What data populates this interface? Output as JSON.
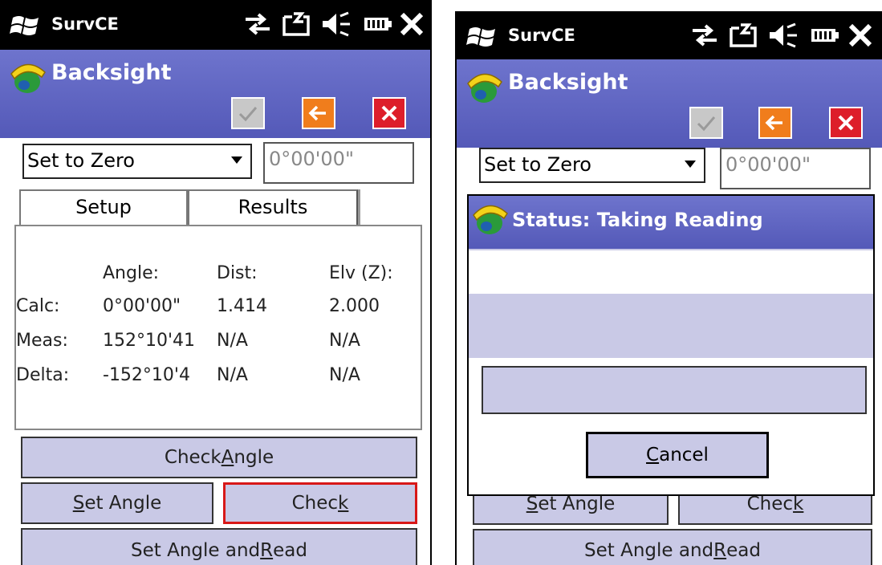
{
  "taskbar": {
    "app_name": "SurvCE",
    "icons": [
      "connectivity-icon",
      "notification-icon",
      "speaker-icon",
      "battery-icon",
      "close-icon"
    ]
  },
  "left": {
    "window_title": "Backsight",
    "mode_select": "Set to Zero",
    "angle_value": "0°00'00\"",
    "tabs": [
      "Setup",
      "Results"
    ],
    "results": {
      "headers": [
        "Angle:",
        "Dist:",
        "Elv (Z):"
      ],
      "rows": [
        {
          "label": "Calc:",
          "angle": "0°00'00\"",
          "dist": "1.414",
          "elv": "2.000"
        },
        {
          "label": "Meas:",
          "angle": "152°10'41",
          "dist": "N/A",
          "elv": "N/A"
        },
        {
          "label": "Delta:",
          "angle": "-152°10'4",
          "dist": "N/A",
          "elv": "N/A"
        }
      ]
    },
    "buttons": {
      "check_angle": {
        "pre": "Check ",
        "key": "A",
        "post": "ngle"
      },
      "set_angle": {
        "pre": "",
        "key": "S",
        "post": "et Angle"
      },
      "check": {
        "pre": "Chec",
        "key": "k",
        "post": ""
      },
      "set_angle_read": {
        "pre": "Set Angle and ",
        "key": "R",
        "post": "ead"
      }
    }
  },
  "right": {
    "window_title": "Backsight",
    "mode_select": "Set to Zero",
    "angle_value": "0°00'00\"",
    "dialog": {
      "title": "Status: Taking Reading",
      "cancel": {
        "pre": "",
        "key": "C",
        "post": "ancel"
      }
    },
    "buttons": {
      "set_angle": {
        "pre": "",
        "key": "S",
        "post": "et Angle"
      },
      "check": {
        "pre": "Chec",
        "key": "k",
        "post": ""
      },
      "set_angle_read": {
        "pre": "Set Angle and ",
        "key": "R",
        "post": "ead"
      }
    }
  },
  "colors": {
    "titlebar": "#5c62c2",
    "button": "#c9c9e6",
    "ok": "#c8c8c8",
    "back": "#f07d1c",
    "close": "#dd1e2a",
    "focus": "#d81818"
  }
}
